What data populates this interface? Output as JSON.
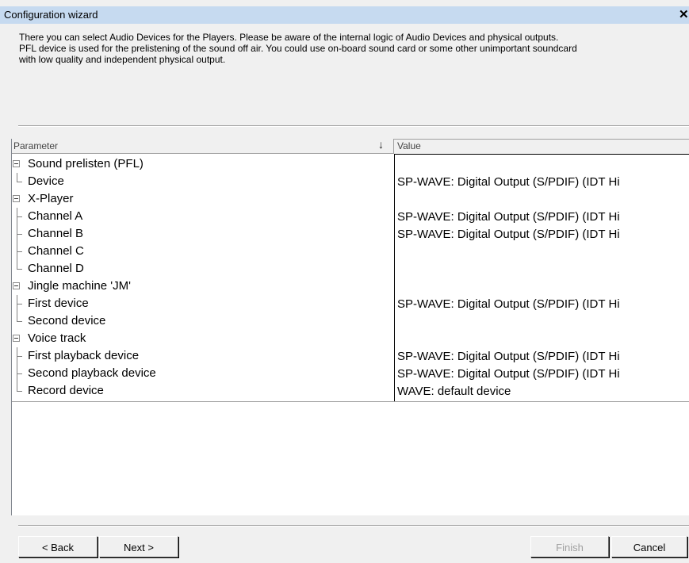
{
  "window": {
    "title": "Configuration wizard",
    "close_glyph": "✕"
  },
  "intro": "There you can select Audio Devices for the Players. Please be aware of the internal logic of Audio Devices and physical outputs.\nPFL device is used for the prelistening of the sound off air. You could use on-board sound card or some other unimportant soundcard\nwith low quality and independent physical output.",
  "grid": {
    "header_parameter": "Parameter",
    "header_value": "Value",
    "sort_icon": "↓",
    "rows": [
      {
        "label": "Sound prelisten (PFL)",
        "value": ""
      },
      {
        "label": "Device",
        "value": "SP-WAVE: Digital Output (S/PDIF) (IDT Hi"
      },
      {
        "label": "X-Player",
        "value": ""
      },
      {
        "label": "Channel A",
        "value": "SP-WAVE: Digital Output (S/PDIF) (IDT Hi"
      },
      {
        "label": "Channel B",
        "value": "SP-WAVE: Digital Output (S/PDIF) (IDT Hi"
      },
      {
        "label": "Channel C",
        "value": ""
      },
      {
        "label": "Channel D",
        "value": ""
      },
      {
        "label": "Jingle machine 'JM'",
        "value": ""
      },
      {
        "label": "First  device",
        "value": "SP-WAVE: Digital Output (S/PDIF) (IDT Hi"
      },
      {
        "label": "Second device",
        "value": ""
      },
      {
        "label": "Voice track",
        "value": ""
      },
      {
        "label": "First playback device",
        "value": "SP-WAVE: Digital Output (S/PDIF) (IDT Hi"
      },
      {
        "label": "Second playback device",
        "value": "SP-WAVE: Digital Output (S/PDIF) (IDT Hi"
      },
      {
        "label": "Record device",
        "value": "WAVE: default device"
      }
    ]
  },
  "buttons": {
    "back": "< Back",
    "next": "Next >",
    "finish": "Finish",
    "cancel": "Cancel"
  },
  "colors": {
    "titlebar": "#c6daf0",
    "window_bg": "#f0f0f0",
    "disabled_text": "#a0a0a0"
  }
}
